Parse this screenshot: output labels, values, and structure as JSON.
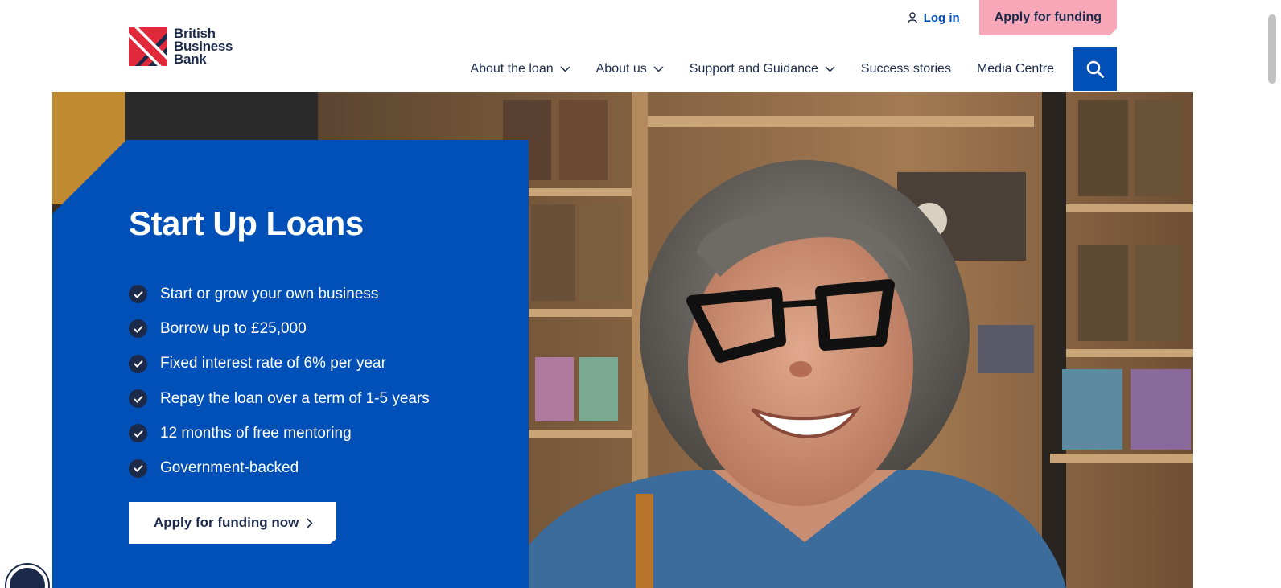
{
  "brand": {
    "line1": "British",
    "line2": "Business",
    "line3": "Bank"
  },
  "utility": {
    "login_label": "Log in",
    "apply_label": "Apply for funding"
  },
  "nav": {
    "items": [
      {
        "label": "About the loan",
        "has_dropdown": true
      },
      {
        "label": "About us",
        "has_dropdown": true
      },
      {
        "label": "Support and Guidance",
        "has_dropdown": true
      },
      {
        "label": "Success stories",
        "has_dropdown": false
      },
      {
        "label": "Media Centre",
        "has_dropdown": false
      }
    ],
    "search_icon": "search-icon"
  },
  "hero": {
    "title": "Start Up Loans",
    "benefits": [
      "Start or grow your own business",
      "Borrow up to £25,000",
      "Fixed interest rate of 6% per year",
      "Repay the loan over a term of 1-5 years",
      "12 months of free mentoring",
      "Government-backed"
    ],
    "cta_label": "Apply for funding now"
  },
  "colors": {
    "brand_blue": "#0050b8",
    "navy": "#1c2a4a",
    "pink": "#f7a7b8",
    "brand_red": "#e0293b"
  }
}
